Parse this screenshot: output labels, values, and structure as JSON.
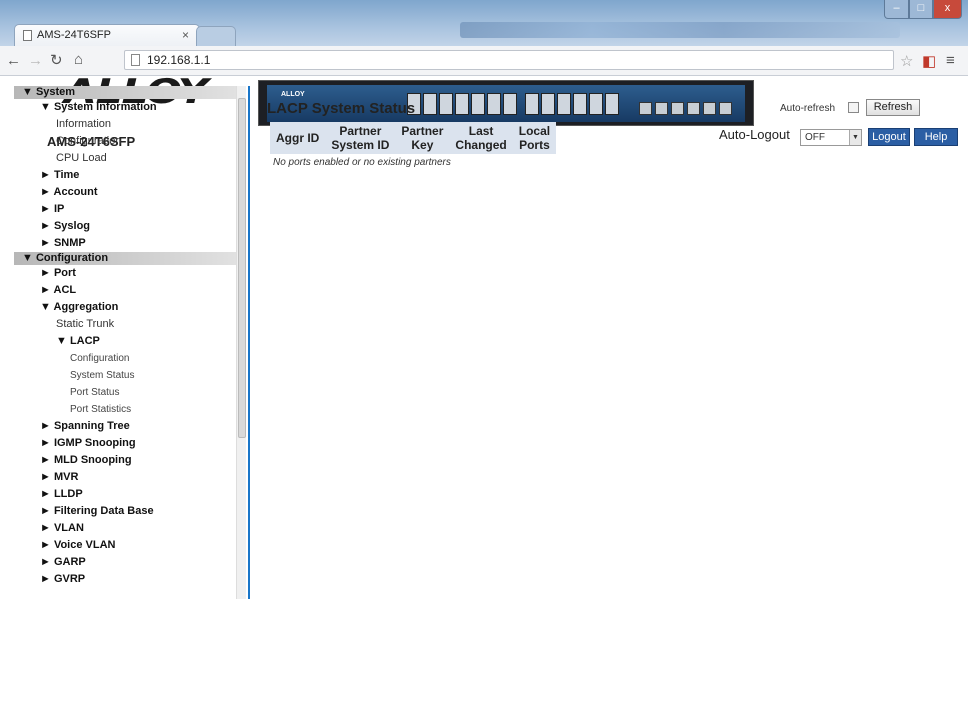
{
  "browser": {
    "tab_title": "AMS-24T6SFP",
    "tab_close": "×",
    "url": "192.168.1.1",
    "window_buttons": [
      "–",
      "□",
      "x"
    ]
  },
  "header": {
    "logo_text": "ALLOY",
    "model": "AMS-24T6SFP",
    "switch_brand": "ALLOY",
    "auto_logout_label": "Auto-Logout",
    "auto_logout_value": "OFF",
    "logout_label": "Logout",
    "help_label": "Help"
  },
  "sidebar": {
    "items": [
      {
        "level": "head",
        "label": "▼ System"
      },
      {
        "level": "l1",
        "label": "▼ System Information"
      },
      {
        "level": "l2",
        "label": "Information"
      },
      {
        "level": "l2",
        "label": "Configuration"
      },
      {
        "level": "l2",
        "label": "CPU Load"
      },
      {
        "level": "l1",
        "label": "► Time"
      },
      {
        "level": "l1",
        "label": "► Account"
      },
      {
        "level": "l1",
        "label": "► IP"
      },
      {
        "level": "l1",
        "label": "► Syslog"
      },
      {
        "level": "l1",
        "label": "► SNMP"
      },
      {
        "level": "head",
        "label": "▼ Configuration"
      },
      {
        "level": "l1",
        "label": "► Port"
      },
      {
        "level": "l1",
        "label": "► ACL"
      },
      {
        "level": "l1",
        "label": "▼ Aggregation"
      },
      {
        "level": "l2",
        "label": "Static Trunk"
      },
      {
        "level": "l1s",
        "label": "▼ LACP"
      },
      {
        "level": "l3",
        "label": "Configuration"
      },
      {
        "level": "l3",
        "label": "System Status"
      },
      {
        "level": "l3",
        "label": "Port Status"
      },
      {
        "level": "l3",
        "label": "Port Statistics"
      },
      {
        "level": "l1",
        "label": "► Spanning Tree"
      },
      {
        "level": "l1",
        "label": "► IGMP Snooping"
      },
      {
        "level": "l1",
        "label": "► MLD Snooping"
      },
      {
        "level": "l1",
        "label": "► MVR"
      },
      {
        "level": "l1",
        "label": "► LLDP"
      },
      {
        "level": "l1",
        "label": "► Filtering Data Base"
      },
      {
        "level": "l1",
        "label": "► VLAN"
      },
      {
        "level": "l1",
        "label": "► Voice VLAN"
      },
      {
        "level": "l1",
        "label": "► GARP"
      },
      {
        "level": "l1",
        "label": "► GVRP"
      }
    ]
  },
  "main": {
    "title": "LACP System Status",
    "auto_refresh_label": "Auto-refresh",
    "refresh_label": "Refresh",
    "columns": [
      [
        "Aggr ID"
      ],
      [
        "Partner",
        "System ID"
      ],
      [
        "Partner",
        "Key"
      ],
      [
        "Last",
        "Changed"
      ],
      [
        "Local",
        "Ports"
      ]
    ],
    "empty_message": "No ports enabled or no existing partners"
  }
}
